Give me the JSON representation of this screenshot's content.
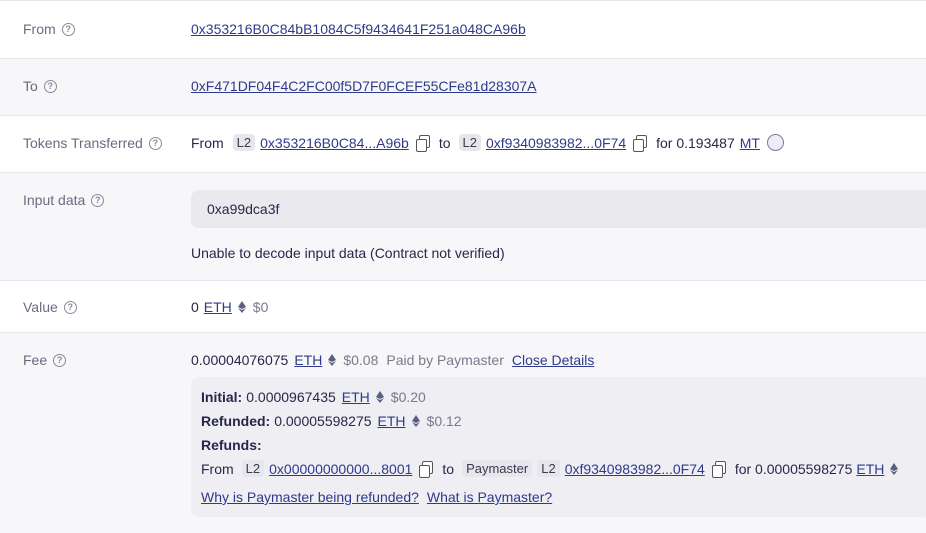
{
  "labels": {
    "from": "From",
    "to": "To",
    "tokens_transferred": "Tokens Transferred",
    "input_data": "Input data",
    "value": "Value",
    "fee": "Fee"
  },
  "from_address": "0x353216B0C84bB1084C5f9434641F251a048CA96b",
  "to_address": "0xF471DF04F4C2FC00f5D7F0FCEF55CFe81d28307A",
  "transfer": {
    "from_word": "From",
    "from_badge": "L2",
    "from_addr": "0x353216B0C84...A96b",
    "to_word": "to",
    "to_badge": "L2",
    "to_addr": "0xf9340983982...0F74",
    "amount": "for 0.193487",
    "token": "MT"
  },
  "input_data": {
    "value": "0xa99dca3f",
    "note": "Unable to decode input data (Contract not verified)"
  },
  "value": {
    "amount": "0",
    "token": "ETH",
    "usd": "$0"
  },
  "fee": {
    "amount": "0.00004076075",
    "token": "ETH",
    "usd": "$0.08",
    "paid_by": "Paid by Paymaster",
    "close_details": "Close Details",
    "initial_label": "Initial:",
    "initial_amount": "0.0000967435",
    "initial_token": "ETH",
    "initial_usd": "$0.20",
    "refunded_label": "Refunded:",
    "refunded_amount": "0.00005598275",
    "refunded_token": "ETH",
    "refunded_usd": "$0.12",
    "refunds_label": "Refunds:",
    "refund_from_word": "From",
    "refund_from_badge": "L2",
    "refund_from_addr": "0x00000000000...8001",
    "refund_to_word": "to",
    "refund_paymaster_badge": "Paymaster",
    "refund_to_badge": "L2",
    "refund_to_addr": "0xf9340983982...0F74",
    "refund_amount": "for 0.00005598275",
    "refund_token": "ETH",
    "link_why": "Why is Paymaster being refunded?",
    "link_what": "What is Paymaster?"
  },
  "colors": {
    "link": "#2e3a8c",
    "row_alt_bg": "#f7f7fa",
    "border": "#e6e6ee"
  }
}
